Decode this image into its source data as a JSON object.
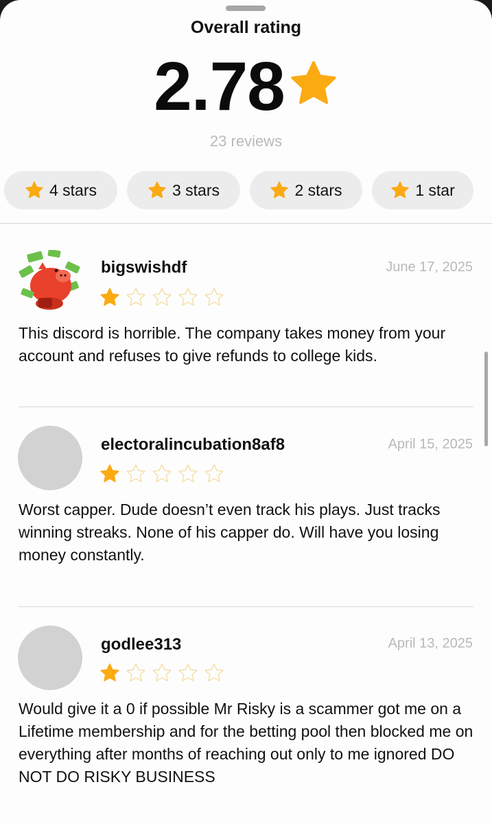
{
  "header": {
    "title": "Overall rating",
    "rating": "2.78",
    "reviews_count": "23 reviews"
  },
  "filters": [
    {
      "label": "4 stars"
    },
    {
      "label": "3 stars"
    },
    {
      "label": "2 stars"
    },
    {
      "label": "1 star"
    }
  ],
  "reviews": [
    {
      "username": "bigswishdf",
      "date": "June 17, 2025",
      "stars": 1,
      "text": "This discord is horrible. The company takes money from your account and refuses to give refunds to college kids.",
      "avatar": "piggy-bank-money-icon"
    },
    {
      "username": "electoralincubation8af8",
      "date": "April 15, 2025",
      "stars": 1,
      "text": "Worst capper. Dude doesn’t even track his plays. Just tracks winning streaks. None of his capper do. Will have you losing money constantly.",
      "avatar": "default-avatar"
    },
    {
      "username": "godlee313",
      "date": "April 13, 2025",
      "stars": 1,
      "text": "Would give it a 0 if possible Mr Risky is a scammer got me on a Lifetime membership and for the betting pool then blocked me on everything after months of reaching out only to me ignored DO NOT DO RISKY BUSINESS",
      "avatar": "default-avatar"
    }
  ],
  "colors": {
    "star_filled": "#FBAA12",
    "star_empty_outline": "#F4DFA8",
    "chip_bg": "#ECECEC",
    "muted_text": "#B9B9B9"
  }
}
